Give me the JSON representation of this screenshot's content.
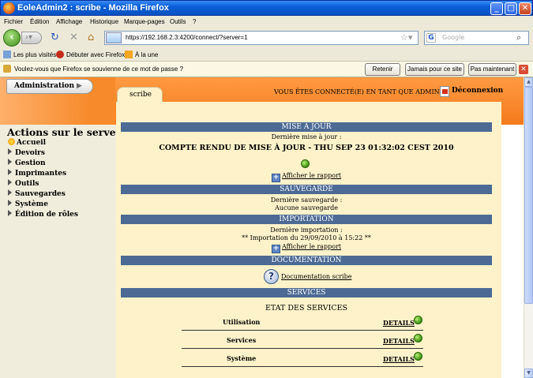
{
  "window": {
    "title": "EoleAdmin2 : scribe - Mozilla Firefox",
    "min_glyph": "_",
    "max_glyph": "□",
    "close_glyph": "✕"
  },
  "menu": [
    "Fichier",
    "Édition",
    "Affichage",
    "Historique",
    "Marque-pages",
    "Outils",
    "?"
  ],
  "nav": {
    "url": "https://192.168.2.3:4200/connect/?server=1",
    "search_placeholder": "Google"
  },
  "bookmarks": [
    "Les plus visités",
    "Débuter avec Firefox",
    "À la une"
  ],
  "password_bar": {
    "message": "Voulez-vous que Firefox se souvienne de ce mot de passe ?",
    "buttons": [
      "Retenir",
      "Jamais pour ce site",
      "Pas maintenant"
    ]
  },
  "header": {
    "admin_tab": "Administration",
    "server_tab": "scribe",
    "connected_text": "VOUS ÊTES CONNECTÉ(E) EN TANT QUE ADMIN",
    "logout": "Déconnexion"
  },
  "sidebar": {
    "title": "Actions sur le serveur",
    "items": [
      "Accueil",
      "Devoirs",
      "Gestion",
      "Imprimantes",
      "Outils",
      "Sauvegardes",
      "Système",
      "Édition de rôles"
    ]
  },
  "sections": {
    "update": {
      "title": "MISE À JOUR",
      "label": "Dernière mise à jour :",
      "report": "COMPTE RENDU DE MISE À JOUR - THU SEP 23 01:32:02 CEST 2010",
      "link": "Afficher le rapport"
    },
    "backup": {
      "title": "SAUVEGARDE",
      "label": "Dernière sauvegarde :",
      "value": "Aucune sauvegarde"
    },
    "import": {
      "title": "IMPORTATION",
      "label": "Dernière importation :",
      "value": "** Importation du 29/09/2010 à 15:22 **",
      "link": "Afficher le rapport"
    },
    "documentation": {
      "title": "DOCUMENTATION",
      "link": "Documentation scribe"
    },
    "services": {
      "title": "SERVICES",
      "subtitle": "ETAT DES SERVICES",
      "rows": [
        {
          "name": "Utilisation",
          "details": "DETAILS"
        },
        {
          "name": "Services",
          "details": "DETAILS"
        },
        {
          "name": "Système",
          "details": "DETAILS"
        }
      ]
    }
  },
  "colors": {
    "section_bar": "#4c6a94",
    "content_bg": "#fdf2c9",
    "header_orange": "#f47b1c",
    "status_ok": "#3e8d12"
  }
}
